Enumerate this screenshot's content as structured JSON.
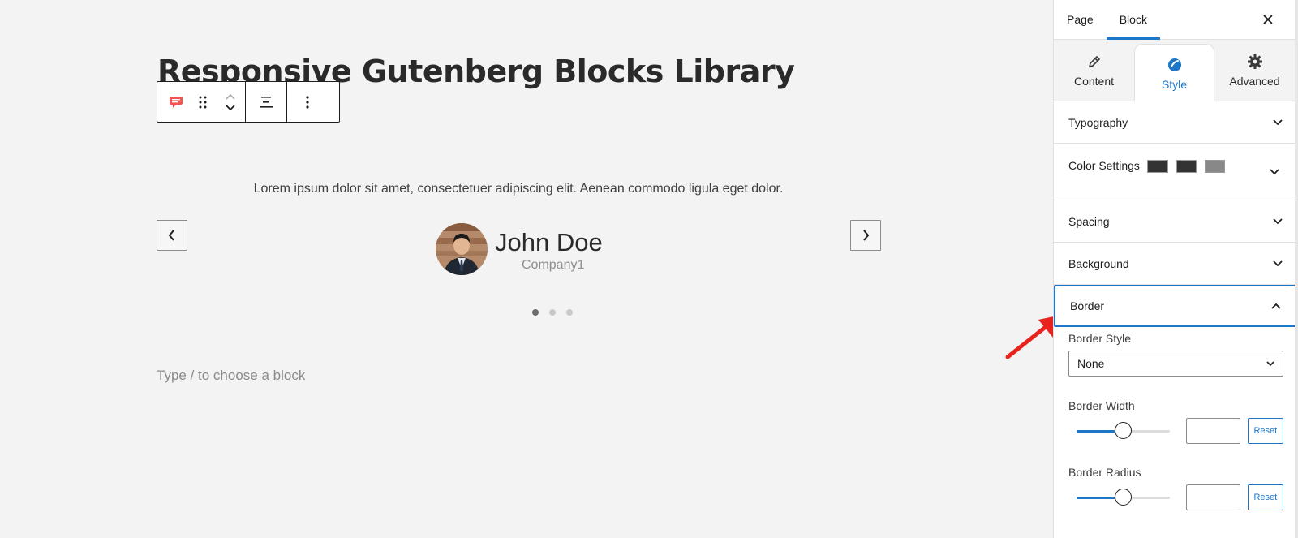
{
  "editor": {
    "page_title": "Responsive Gutenberg Blocks Library",
    "testimonial": {
      "quote": "Lorem ipsum dolor sit amet, consectetuer adipiscing elit. Aenean commodo ligula eget dolor.",
      "name": "John Doe",
      "company": "Company1",
      "slide_count": 3,
      "active_slide": 1
    },
    "appender_placeholder": "Type / to choose a block"
  },
  "sidebar": {
    "tabs": {
      "page": "Page",
      "block": "Block",
      "active": "Block"
    },
    "panel_tabs": {
      "content": "Content",
      "style": "Style",
      "advanced": "Advanced",
      "active": "Style"
    },
    "sections": {
      "typography": "Typography",
      "color_settings": "Color Settings",
      "spacing": "Spacing",
      "background": "Background",
      "border": "Border"
    },
    "color_swatches": [
      "#333333",
      "#333333",
      "#888888",
      "#333333"
    ],
    "border": {
      "style_label": "Border Style",
      "style_value": "None",
      "width_label": "Border Width",
      "width_value": "",
      "width_slider_fraction": 0.5,
      "radius_label": "Border Radius",
      "radius_value": "",
      "radius_slider_fraction": 0.5,
      "reset_label": "Reset"
    }
  },
  "colors": {
    "accent": "#1e76c8",
    "annotation_arrow": "#e8231d",
    "brand_icon": "#f0544f"
  }
}
